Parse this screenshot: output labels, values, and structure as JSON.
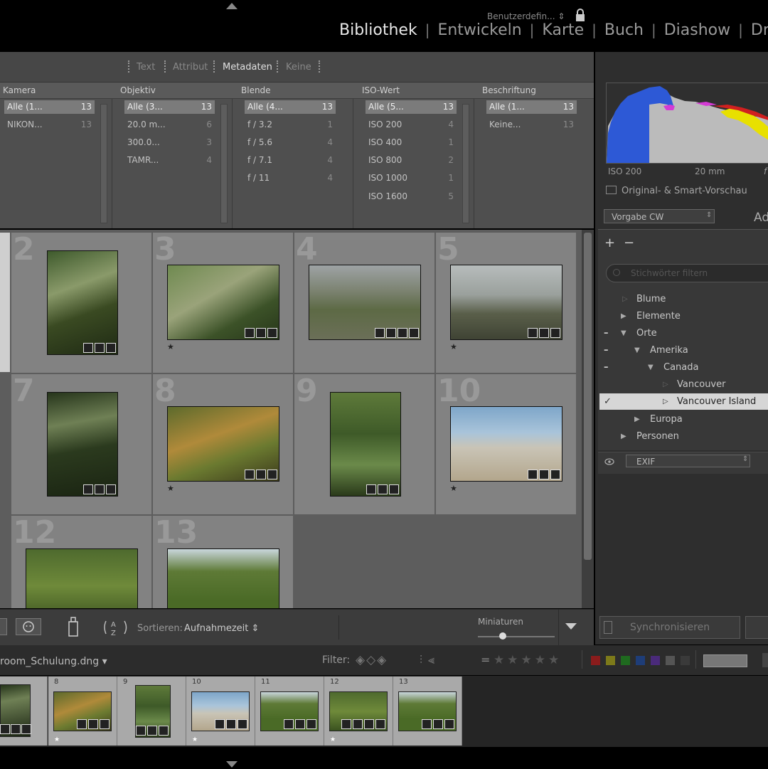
{
  "modules": [
    "Bibliothek",
    "Entwickeln",
    "Karte",
    "Buch",
    "Diashow",
    "Dru"
  ],
  "active_module": "Bibliothek",
  "filterbar": {
    "tabs": [
      "Text",
      "Attribut",
      "Metadaten",
      "Keine"
    ],
    "active_tab": "Metadaten",
    "preset": "Benutzerdefin... ⇕"
  },
  "metadata_columns": [
    {
      "header": "Kamera",
      "rows": [
        {
          "label": "Alle (1...",
          "count": "13",
          "selected": true
        },
        {
          "label": "NIKON...",
          "count": "13"
        }
      ]
    },
    {
      "header": "Objektiv",
      "rows": [
        {
          "label": "Alle (3...",
          "count": "13",
          "selected": true
        },
        {
          "label": "20.0 m...",
          "count": "6"
        },
        {
          "label": "300.0...",
          "count": "3"
        },
        {
          "label": "TAMR...",
          "count": "4"
        }
      ]
    },
    {
      "header": "Blende",
      "rows": [
        {
          "label": "Alle (4...",
          "count": "13",
          "selected": true
        },
        {
          "label": "f / 3.2",
          "count": "1"
        },
        {
          "label": "f / 5.6",
          "count": "4"
        },
        {
          "label": "f / 7.1",
          "count": "4"
        },
        {
          "label": "f / 11",
          "count": "4"
        }
      ]
    },
    {
      "header": "ISO-Wert",
      "rows": [
        {
          "label": "Alle (5...",
          "count": "13",
          "selected": true
        },
        {
          "label": "ISO 200",
          "count": "4"
        },
        {
          "label": "ISO 400",
          "count": "1"
        },
        {
          "label": "ISO 800",
          "count": "2"
        },
        {
          "label": "ISO 1000",
          "count": "1"
        },
        {
          "label": "ISO 1600",
          "count": "5"
        }
      ]
    },
    {
      "header": "Beschriftung",
      "rows": [
        {
          "label": "Alle (1...",
          "count": "13",
          "selected": true
        },
        {
          "label": "Keine...",
          "count": "13"
        }
      ]
    }
  ],
  "grid": {
    "cells": [
      {
        "num": "2",
        "star": false
      },
      {
        "num": "3",
        "star": true
      },
      {
        "num": "4",
        "star": false
      },
      {
        "num": "5",
        "star": true
      },
      {
        "num": "7",
        "star": false
      },
      {
        "num": "8",
        "star": true
      },
      {
        "num": "9",
        "star": false
      },
      {
        "num": "10",
        "star": true
      },
      {
        "num": "12",
        "star": false
      },
      {
        "num": "13",
        "star": false
      }
    ]
  },
  "toolbar": {
    "sort_label": "Sortieren:",
    "sort_value": "Aufnahmezeit ⇕",
    "thumbnails_label": "Miniaturen"
  },
  "histogram": {
    "iso": "ISO 200",
    "focal": "20 mm",
    "f_partial": "f",
    "smart_preview": "Original- & Smart-Vorschau"
  },
  "keywording": {
    "preset": "Vorgabe CW",
    "panel_label_partial": "Ad",
    "filter_placeholder": "Stichwörter filtern",
    "keywords": [
      {
        "label": "Blume",
        "level": 0,
        "arrow": "none",
        "mark": "",
        "selected": false
      },
      {
        "label": "Elemente",
        "level": 0,
        "arrow": "right",
        "mark": "",
        "selected": false
      },
      {
        "label": "Orte",
        "level": 0,
        "arrow": "down",
        "mark": "–",
        "selected": false
      },
      {
        "label": "Amerika",
        "level": 1,
        "arrow": "down",
        "mark": "–",
        "selected": false
      },
      {
        "label": "Canada",
        "level": 2,
        "arrow": "down",
        "mark": "–",
        "selected": false
      },
      {
        "label": "Vancouver",
        "level": 3,
        "arrow": "none",
        "mark": "",
        "selected": false
      },
      {
        "label": "Vancouver Island",
        "level": 3,
        "arrow": "none",
        "mark": "✓",
        "selected": true
      },
      {
        "label": "Europa",
        "level": 1,
        "arrow": "right",
        "mark": "",
        "selected": false
      },
      {
        "label": "Personen",
        "level": 0,
        "arrow": "right",
        "mark": "",
        "selected": false
      }
    ],
    "metadata_preset": "EXIF"
  },
  "sync_button": "Synchronisieren",
  "filmstrip": {
    "source": "room_Schulung.dng ▾",
    "filter_label": "Filter:",
    "equals": "=",
    "stars": "★★★★★",
    "colors": [
      "#8a1c1c",
      "#7d7a1a",
      "#1f6a1f",
      "#1e3d78",
      "#4a2a7a",
      "#555555",
      "#3a3a3a"
    ],
    "cells": [
      {
        "num": "",
        "star": false
      },
      {
        "num": "8",
        "star": true
      },
      {
        "num": "9",
        "star": false
      },
      {
        "num": "10",
        "star": true
      },
      {
        "num": "11",
        "star": false
      },
      {
        "num": "12",
        "star": true
      },
      {
        "num": "13",
        "star": false
      }
    ]
  }
}
